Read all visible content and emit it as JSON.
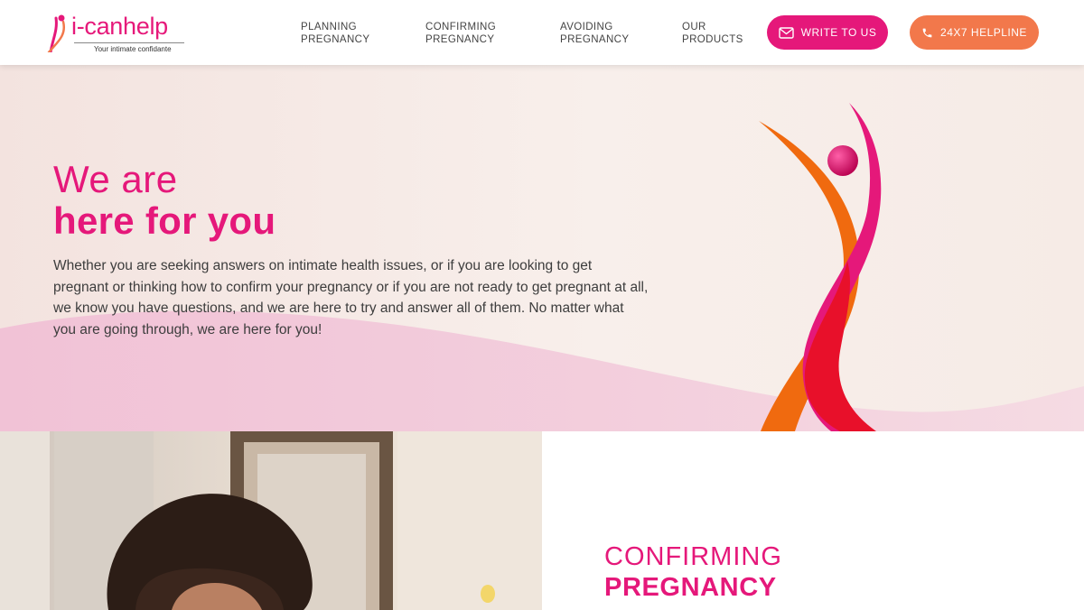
{
  "brand": {
    "name": "i-canhelp",
    "tagline": "Your intimate confidante",
    "accent_color": "#e5187a",
    "secondary_color": "#f2784b"
  },
  "nav": {
    "items": [
      {
        "line1": "PLANNING",
        "line2": "PREGNANCY"
      },
      {
        "line1": "CONFIRMING",
        "line2": "PREGNANCY"
      },
      {
        "line1": "AVOIDING",
        "line2": "PREGNANCY"
      },
      {
        "line1": "OUR",
        "line2": "PRODUCTS"
      }
    ],
    "write_button": {
      "label": "WRITE TO US",
      "icon": "mail-icon"
    },
    "helpline_button": {
      "label": "24X7 HELPLINE",
      "icon": "phone-icon"
    }
  },
  "hero": {
    "title_line1": "We are",
    "title_line2": "here for you",
    "body": "Whether you are seeking answers on intimate health issues, or if you are looking to get pregnant or thinking how to confirm your pregnancy or if you are not ready to get pregnant at all, we know you have questions, and we are here to try and answer all of them. No matter what you are going through, we are here for you!"
  },
  "section": {
    "title_line1": "CONFIRMING",
    "title_line2": "PREGNANCY",
    "image": "woman-photo"
  }
}
